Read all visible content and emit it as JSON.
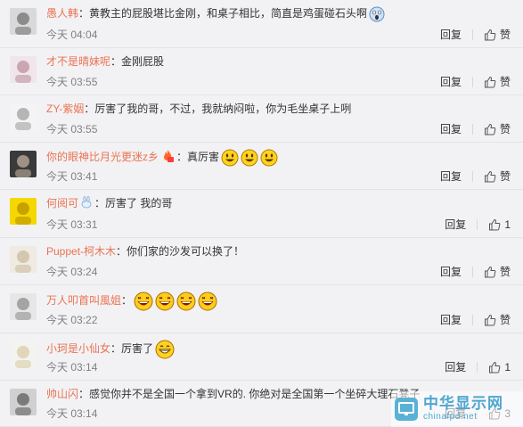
{
  "comments": [
    {
      "user": "愚人韩",
      "sep": "：",
      "text": "黄教主的屁股堪比金刚，和桌子相比，简直是鸡蛋碰石头啊",
      "time": "今天 04:04",
      "reply": "回复",
      "like": "赞",
      "emojis": [
        "scream"
      ],
      "badge": ""
    },
    {
      "user": "才不是晴妹呢",
      "sep": "：",
      "text": "金刚屁股",
      "time": "今天 03:55",
      "reply": "回复",
      "like": "赞",
      "emojis": [],
      "badge": ""
    },
    {
      "user": "ZY-紫姻",
      "sep": "：",
      "text": "厉害了我的哥，不过，我就纳闷啦，你为毛坐桌子上咧",
      "time": "今天 03:55",
      "reply": "回复",
      "like": "赞",
      "emojis": [],
      "badge": ""
    },
    {
      "user": "你的眼神比月光更迷z乡",
      "sep": "：",
      "text": "真厉害",
      "time": "今天 03:41",
      "reply": "回复",
      "like": "赞",
      "emojis": [
        "grin",
        "grin",
        "grin"
      ],
      "badge": "fire-icon"
    },
    {
      "user": "何阅可",
      "sep": "：",
      "text": "厉害了 我的哥",
      "time": "今天 03:31",
      "reply": "回复",
      "like": "1",
      "emojis": [],
      "badge": "rabbit-icon"
    },
    {
      "user": "Puppet-柯木木",
      "sep": "：",
      "text": "你们家的沙发可以换了！",
      "time": "今天 03:24",
      "reply": "回复",
      "like": "赞",
      "emojis": [],
      "badge": ""
    },
    {
      "user": "万人叩首叫風姐",
      "sep": "：",
      "text": "",
      "time": "今天 03:22",
      "reply": "回复",
      "like": "赞",
      "emojis": [
        "laugh",
        "laugh",
        "laugh",
        "laugh"
      ],
      "badge": ""
    },
    {
      "user": "小珂是小仙女",
      "sep": "：",
      "text": "厉害了",
      "time": "今天 03:14",
      "reply": "回复",
      "like": "1",
      "emojis": [
        "bigsmile"
      ],
      "badge": ""
    },
    {
      "user": "帅山闪",
      "sep": "：",
      "text": "感觉你并不是全国一个拿到VR的. 你绝对是全国第一个坐碎大理石凳子",
      "time": "今天 03:14",
      "reply": "回复",
      "like": "3",
      "emojis": [],
      "badge": ""
    }
  ],
  "watermark": {
    "name": "中华显示网",
    "url": "chinafpd.net"
  }
}
